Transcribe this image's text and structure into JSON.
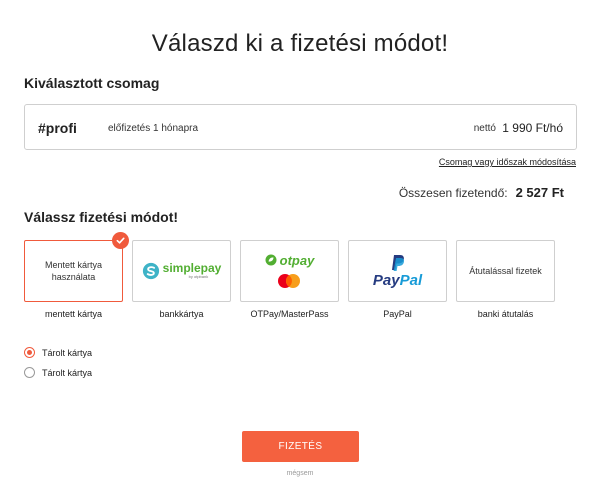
{
  "page": {
    "title": "Válaszd ki a fizetési módot!"
  },
  "package_section": {
    "heading": "Kiválasztott csomag",
    "name": "#profi",
    "description": "előfizetés 1 hónapra",
    "price_label": "nettó",
    "price": "1 990 Ft/hó",
    "modify_link": "Csomag vagy időszak módosítása"
  },
  "total": {
    "label": "Összesen fizetendő:",
    "value": "2 527 Ft"
  },
  "payment_section": {
    "heading": "Válassz fizetési módot!",
    "methods": [
      {
        "label": "Mentett kártya használata",
        "caption": "mentett kártya",
        "selected": true
      },
      {
        "logo": "simplepay",
        "logo_text": "simplepay",
        "logo_subtext": "by otpbank",
        "caption": "bankkártya"
      },
      {
        "logo": "otpay",
        "logo_text": "otpay",
        "caption": "OTPay/MasterPass"
      },
      {
        "logo": "paypal",
        "logo_text_1": "Pay",
        "logo_text_2": "Pal",
        "caption": "PayPal"
      },
      {
        "label": "Átutalással fizetek",
        "caption": "banki átutalás"
      }
    ]
  },
  "saved_cards": [
    {
      "label": "Tárolt kártya",
      "checked": true
    },
    {
      "label": "Tárolt kártya",
      "checked": false
    }
  ],
  "colors": {
    "accent": "#f4613f",
    "otp_green": "#52ae32",
    "paypal_dark": "#253b80",
    "paypal_light": "#179bd7"
  },
  "actions": {
    "pay_button": "FIZETÉS",
    "back_link": "mégsem"
  }
}
